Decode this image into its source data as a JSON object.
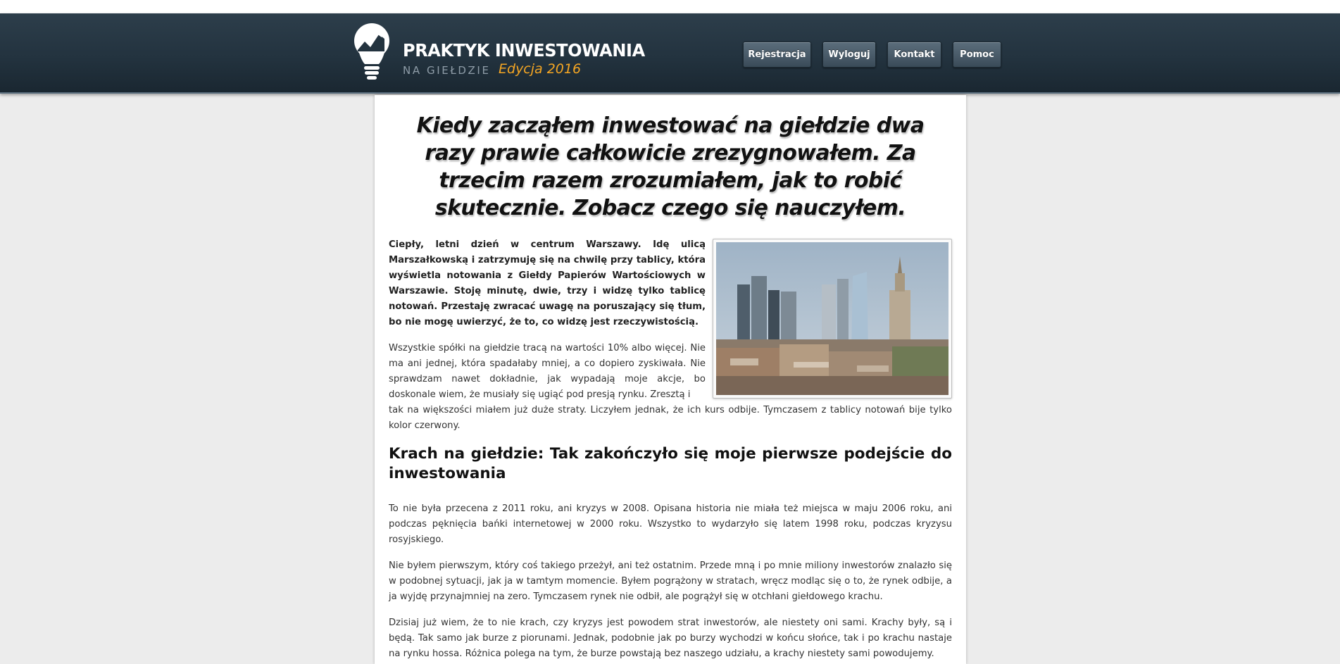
{
  "header": {
    "logo_title": "PRAKTYK INWESTOWANIA",
    "logo_subtitle": "NA GIEŁDZIE",
    "logo_edition": "Edycja 2016",
    "logo_icon": "lightbulb-chart-icon",
    "accent_color": "#f5a623",
    "background_color": "#23333f",
    "nav": [
      {
        "label": "Rejestracja"
      },
      {
        "label": "Wyloguj"
      },
      {
        "label": "Kontakt"
      },
      {
        "label": "Pomoc"
      }
    ]
  },
  "article": {
    "headline": "Kiedy zacząłem inwestować na giełdzie dwa razy prawie całkowicie zrezygnowałem. Za trzecim razem zrozumiałem, jak to robić skutecznie. Zobacz czego się nauczyłem.",
    "lead": "Ciepły, letni dzień w centrum Warszawy. Idę ulicą Marszałkowską i zatrzymuję się na chwilę przy tablicy, która wyświetla notowania z Giełdy Papierów Wartościowych w Warszawie. Stoję minutę, dwie, trzy i widzę tylko tablicę notowań. Przestaję zwracać uwagę na poruszający się tłum, bo nie mogę uwierzyć, że to, co widzę jest rzeczywistością.",
    "paragraph1_part1": "Wszystkie spółki na giełdzie tracą na wartości 10% albo więcej. Nie ma ani jednej, która spadałaby mniej, a co dopiero zyskiwała. Nie sprawdzam nawet dokładnie, jak wypadają moje akcje, bo doskonale wiem, że musiały się ugiąć pod presją rynku. Zresztą i",
    "paragraph1_part2": "tak na większości miałem już duże straty. Liczyłem jednak, że ich kurs odbije. Tymczasem z tablicy notowań bije tylko kolor czerwony.",
    "subheading": "Krach na giełdzie: Tak zakończyło się moje pierwsze podejście do inwestowania",
    "paragraph2": "To nie była przecena z 2011 roku, ani kryzys w 2008. Opisana historia nie miała też miejsca w maju 2006 roku, ani podczas pęknięcia bańki internetowej w 2000 roku. Wszystko to wydarzyło się latem 1998 roku, podczas kryzysu rosyjskiego.",
    "paragraph3": "Nie byłem pierwszym, który coś takiego przeżył, ani też ostatnim. Przede mną i po mnie miliony inwestorów znalazło się w podobnej sytuacji, jak ja w tamtym momencie. Byłem pogrążony w stratach, wręcz modląc się o to, że rynek odbije, a ja wyjdę przynajmniej na zero. Tymczasem rynek nie odbił, ale pogrążył się w otchłani giełdowego krachu.",
    "paragraph4": "Dzisiaj już wiem, że to nie krach, czy kryzys jest powodem strat inwestorów, ale niestety oni sami. Krachy były, są i będą. Tak samo jak burze z piorunami. Jednak, podobnie jak po burzy wychodzi w końcu słońce, tak i po krachu nastaje na rynku hossa. Różnica polega na tym, że burze powstają bez naszego udziału, a krachy niestety sami powodujemy."
  }
}
